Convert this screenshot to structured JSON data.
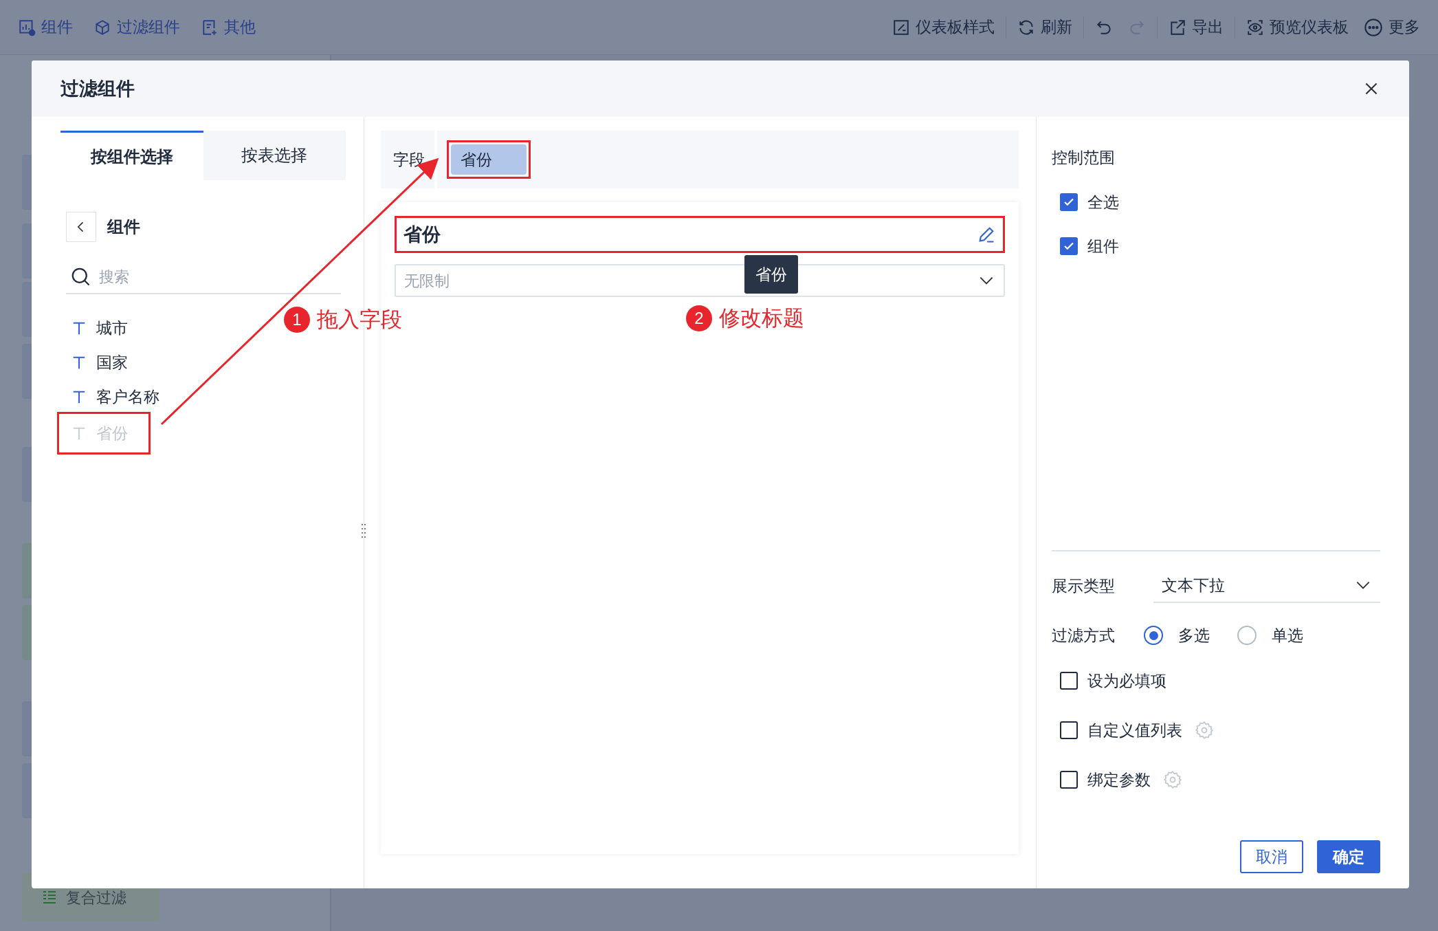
{
  "toolbar": {
    "left": [
      {
        "kind": "widget",
        "label": "组件"
      },
      {
        "kind": "filter",
        "label": "过滤组件"
      },
      {
        "kind": "other",
        "label": "其他"
      }
    ],
    "right": [
      {
        "kind": "style",
        "label": "仪表板样式",
        "disabled": false
      },
      {
        "kind": "refresh",
        "label": "刷新",
        "disabled": false
      },
      {
        "kind": "undo",
        "disabled": false
      },
      {
        "kind": "redo",
        "disabled": true
      },
      {
        "kind": "export",
        "label": "导出",
        "disabled": false
      },
      {
        "kind": "preview",
        "label": "预览仪表板",
        "disabled": false
      },
      {
        "kind": "more",
        "label": "更多",
        "disabled": false
      }
    ]
  },
  "background_sidebar": {
    "item": "复合过滤"
  },
  "dialog": {
    "title": "过滤组件",
    "left_tabs": [
      {
        "label": "按组件选择",
        "selected": true
      },
      {
        "label": "按表选择",
        "selected": false
      }
    ],
    "group": "组件",
    "search": {
      "placeholder": "搜索"
    },
    "fields": [
      {
        "label": "城市",
        "disabled": false,
        "highlighted": false
      },
      {
        "label": "国家",
        "disabled": false,
        "highlighted": false
      },
      {
        "label": "客户名称",
        "disabled": false,
        "highlighted": false
      },
      {
        "label": "省份",
        "disabled": true,
        "highlighted": true
      }
    ],
    "field_bar": {
      "label": "字段",
      "chip": "省份",
      "highlighted": true
    },
    "preview": {
      "title": "省份",
      "title_highlighted": true,
      "select_placeholder": "无限制",
      "tooltip": "省份"
    },
    "annotations": [
      {
        "number": "1",
        "text": "拖入字段"
      },
      {
        "number": "2",
        "text": "修改标题"
      }
    ],
    "control_scope": {
      "title": "控制范围",
      "options": [
        {
          "label": "全选",
          "checked": true
        },
        {
          "label": "组件",
          "checked": true
        }
      ]
    },
    "display_type": {
      "label": "展示类型",
      "value": "文本下拉"
    },
    "filter_mode": {
      "label": "过滤方式",
      "options": [
        {
          "label": "多选",
          "selected": true
        },
        {
          "label": "单选",
          "selected": false
        }
      ]
    },
    "options": [
      {
        "label": "设为必填项",
        "checked": false,
        "gear": false
      },
      {
        "label": "自定义值列表",
        "checked": false,
        "gear": true
      },
      {
        "label": "绑定参数",
        "checked": false,
        "gear": true
      }
    ],
    "buttons": [
      {
        "kind": "secondary",
        "label": "取消"
      },
      {
        "kind": "primary",
        "label": "确定"
      }
    ]
  }
}
